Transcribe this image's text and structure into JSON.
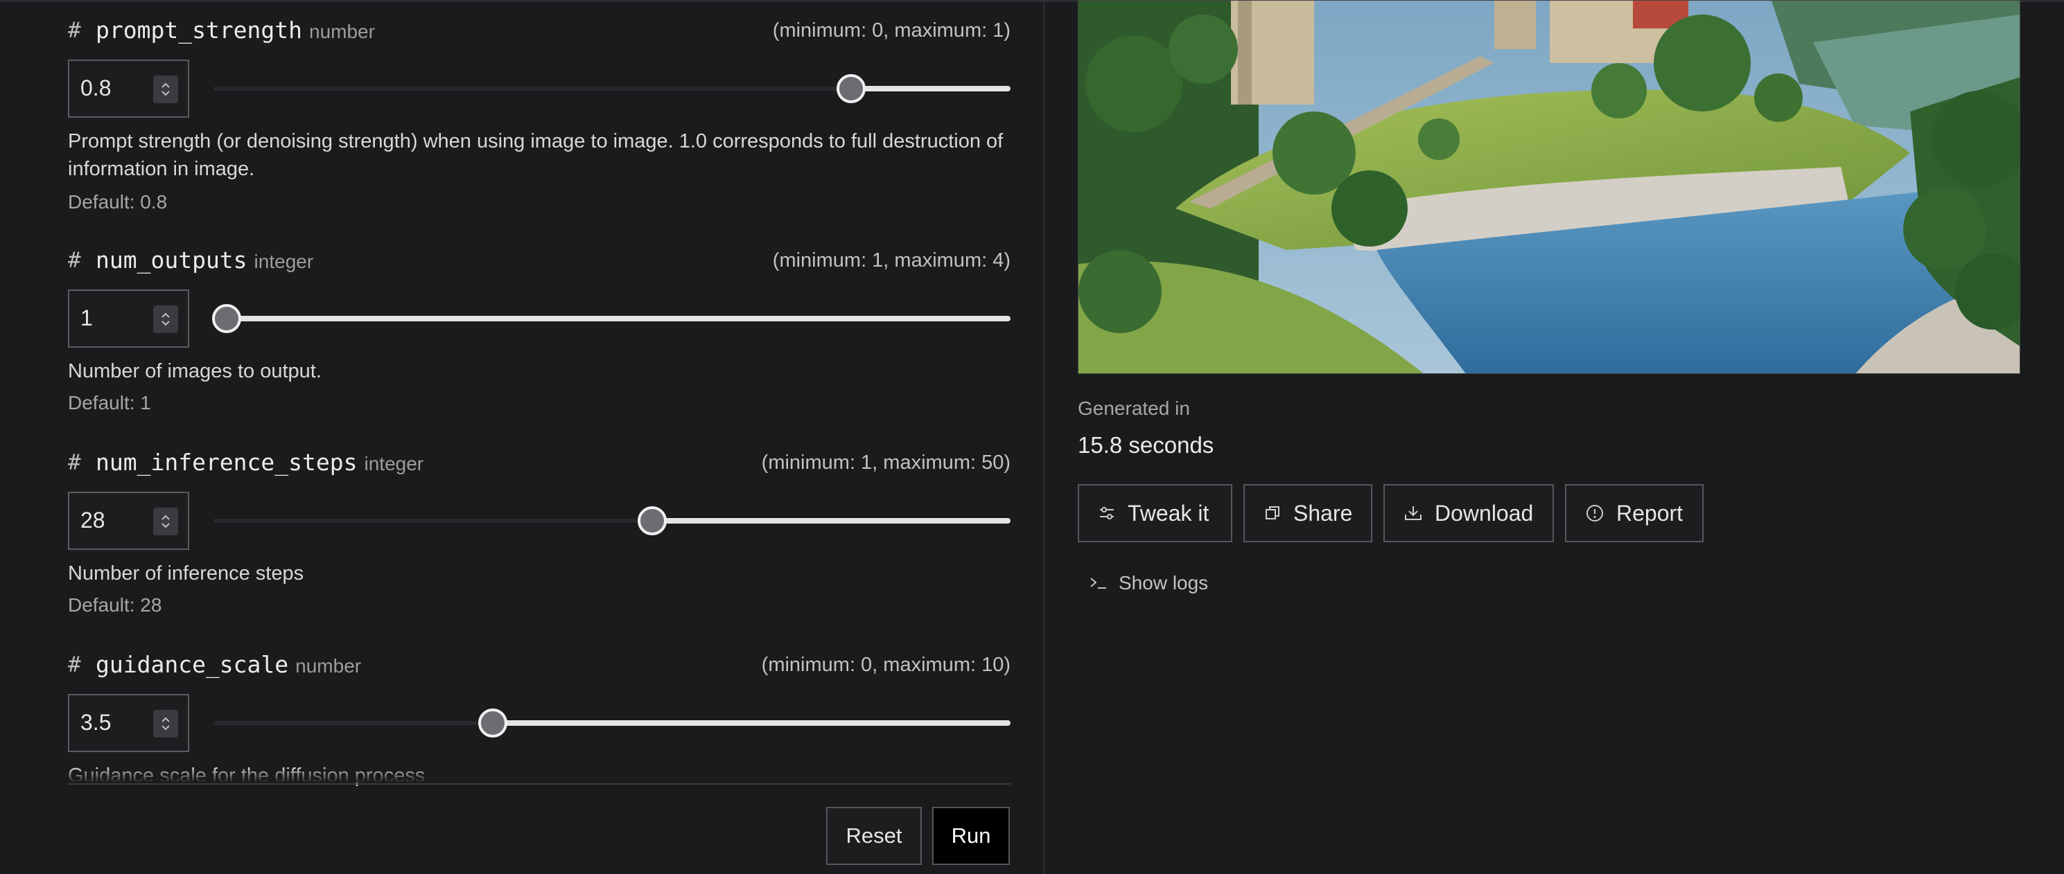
{
  "params": [
    {
      "name": "prompt_strength",
      "type": "number",
      "range": "(minimum: 0, maximum: 1)",
      "value": "0.8",
      "slider_fraction": 0.8,
      "description": "Prompt strength (or denoising strength) when using image to image. 1.0 corresponds to full destruction of information in image.",
      "default": "Default: 0.8"
    },
    {
      "name": "num_outputs",
      "type": "integer",
      "range": "(minimum: 1, maximum: 4)",
      "value": "1",
      "slider_fraction": 0.0,
      "description": "Number of images to output.",
      "default": "Default: 1"
    },
    {
      "name": "num_inference_steps",
      "type": "integer",
      "range": "(minimum: 1, maximum: 50)",
      "value": "28",
      "slider_fraction": 0.55,
      "description": "Number of inference steps",
      "default": "Default: 28"
    },
    {
      "name": "guidance_scale",
      "type": "number",
      "range": "(minimum: 0, maximum: 10)",
      "value": "3.5",
      "slider_fraction": 0.35,
      "description": "Guidance scale for the diffusion process"
    }
  ],
  "form_actions": {
    "reset_label": "Reset",
    "run_label": "Run"
  },
  "output": {
    "generated_label": "Generated in",
    "generated_value": "15.8 seconds",
    "buttons": {
      "tweak": "Tweak it",
      "share": "Share",
      "download": "Download",
      "report": "Report"
    },
    "show_logs": "Show logs"
  },
  "icons": {
    "numbox_spinner": "chevron-up-down-icon",
    "tweak": "sliders-icon",
    "share": "copy-icon",
    "download": "download-icon",
    "report": "alert-circle-icon",
    "logs": "terminal-prompt-icon"
  }
}
